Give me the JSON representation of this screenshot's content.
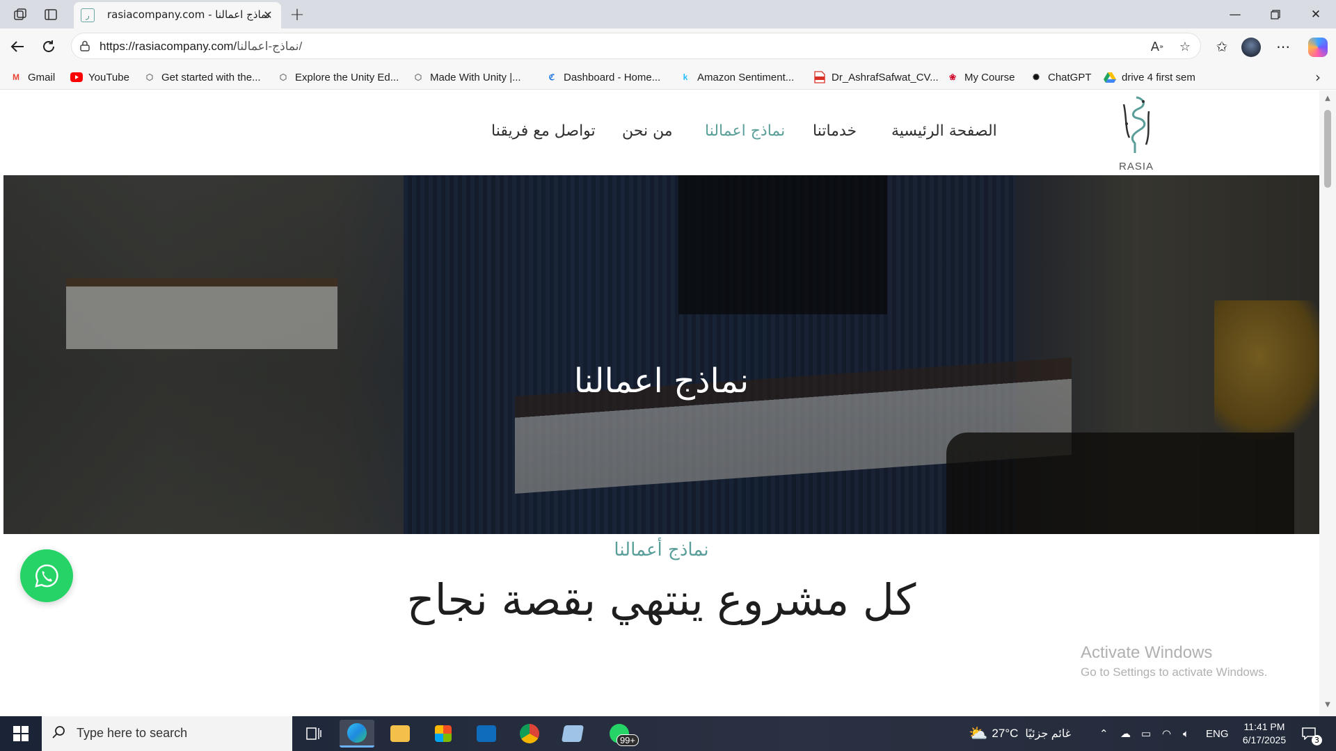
{
  "browser": {
    "tab_title": "rasiacompany.com - نماذج اعمالنا",
    "url_base": "https://rasiacompany.com/",
    "url_path": "نماذج-اعمالنا/",
    "bookmarks": [
      {
        "label": "Gmail",
        "icon": "gmail-icon",
        "color": "#ea4335"
      },
      {
        "label": "YouTube",
        "icon": "youtube-icon",
        "color": "#ff0000"
      },
      {
        "label": "Get started with the...",
        "icon": "unity-icon",
        "color": "#666666"
      },
      {
        "label": "Explore the Unity Ed...",
        "icon": "unity-icon",
        "color": "#666666"
      },
      {
        "label": "Made With Unity |...",
        "icon": "unity-icon",
        "color": "#666666"
      },
      {
        "label": "Dashboard - Home...",
        "icon": "dashboard-icon",
        "color": "#1a73e8"
      },
      {
        "label": "Amazon Sentiment...",
        "icon": "kaggle-icon",
        "color": "#20beff"
      },
      {
        "label": "Dr_AshrafSafwat_CV...",
        "icon": "pdf-icon",
        "color": "#d93025"
      },
      {
        "label": "My Course",
        "icon": "huawei-icon",
        "color": "#cf0a2c"
      },
      {
        "label": "ChatGPT",
        "icon": "chatgpt-icon",
        "color": "#111111"
      },
      {
        "label": "drive 4 first sem",
        "icon": "drive-icon",
        "color": "#1fa463"
      }
    ]
  },
  "site": {
    "logo_text": "RASIA",
    "nav": [
      {
        "label": "الصفحة الرئيسية",
        "active": false
      },
      {
        "label": "خدماتنا",
        "active": false
      },
      {
        "label": "نماذج اعمالنا",
        "active": true
      },
      {
        "label": "من نحن",
        "active": false
      },
      {
        "label": "تواصل مع فريقنا",
        "active": false
      }
    ],
    "hero_title": "نماذج اعمالنا",
    "section_subtitle": "نماذج أعمالنا",
    "section_title": "كل مشروع ينتهي بقصة نجاح"
  },
  "watermark": {
    "line1": "Activate Windows",
    "line2": "Go to Settings to activate Windows."
  },
  "taskbar": {
    "search_placeholder": "Type here to search",
    "whatsapp_badge": "99+",
    "weather_temp": "27°C",
    "weather_text": "غائم جزئيًا",
    "language": "ENG",
    "time": "11:41 PM",
    "date": "6/17/2025",
    "notification_count": "3"
  },
  "colors": {
    "accent_teal": "#5a9e9a",
    "whatsapp_green": "#25d366"
  }
}
